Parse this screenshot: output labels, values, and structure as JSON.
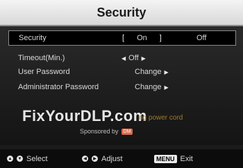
{
  "title": "Security",
  "rows": [
    {
      "label": "Security",
      "value": "On",
      "alt": "Off"
    },
    {
      "label": "Timeout(Min.)",
      "value": "Off"
    },
    {
      "label": "User Password",
      "value": "Change"
    },
    {
      "label": "Administrator Password",
      "value": "Change"
    }
  ],
  "watermark": {
    "text": "FixYourDLP.com",
    "hint": "ng power cord",
    "sponsor": "Sponsored by",
    "logo": "DM"
  },
  "footer": {
    "select": "Select",
    "adjust": "Adjust",
    "menu_key": "MENU",
    "exit": "Exit"
  }
}
